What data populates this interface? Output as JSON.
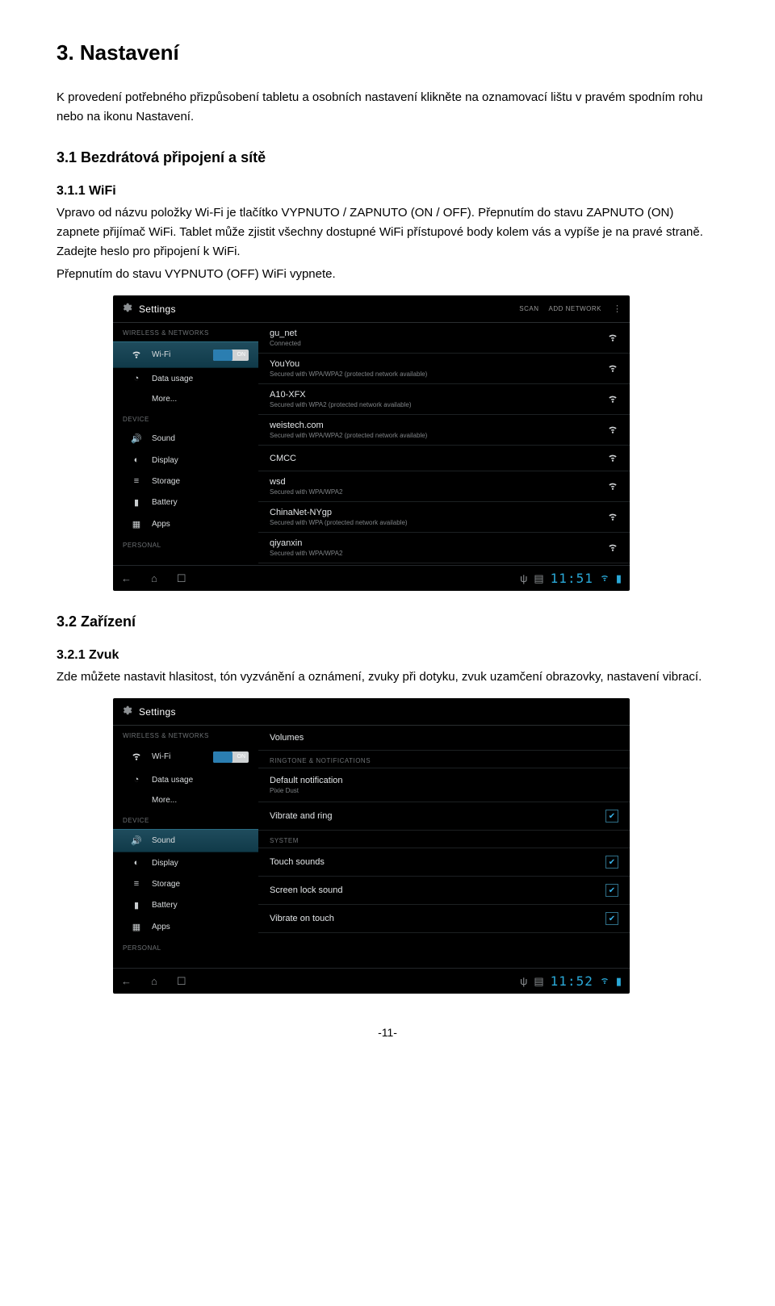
{
  "doc": {
    "h1": "3. Nastavení",
    "p1": "K provedení potřebného přizpůsobení tabletu a osobních nastavení klikněte na oznamovací lištu v pravém spodním rohu nebo na ikonu Nastavení.",
    "h2_1": "3.1 Bezdrátová připojení a sítě",
    "h3_1": "3.1.1 WiFi",
    "p2": "Vpravo od názvu položky Wi-Fi je tlačítko VYPNUTO / ZAPNUTO (ON / OFF). Přepnutím do stavu ZAPNUTO (ON) zapnete přijímač WiFi. Tablet může zjistit všechny dostupné WiFi přístupové body kolem vás a vypíše je na pravé straně. Zadejte heslo pro připojení k WiFi.",
    "p3": "Přepnutím do stavu VYPNUTO (OFF) WiFi vypnete.",
    "h2_2": "3.2 Zařízení",
    "h3_2": "3.2.1 Zvuk",
    "p4": "Zde můžete nastavit hlasitost, tón vyzvánění a oznámení, zvuky při dotyku, zvuk uzamčení obrazovky, nastavení vibrací.",
    "pagenum": "-11-"
  },
  "shot1": {
    "header": {
      "title": "Settings",
      "scan": "SCAN",
      "add": "ADD NETWORK"
    },
    "sidebar": {
      "sect_wireless": "WIRELESS & NETWORKS",
      "wifi": "Wi-Fi",
      "toggle_on": "ON",
      "data": "Data usage",
      "more": "More...",
      "sect_device": "DEVICE",
      "sound": "Sound",
      "display": "Display",
      "storage": "Storage",
      "battery": "Battery",
      "apps": "Apps",
      "sect_personal": "PERSONAL"
    },
    "networks": [
      {
        "name": "gu_net",
        "sub": "Connected"
      },
      {
        "name": "YouYou",
        "sub": "Secured with WPA/WPA2 (protected network available)"
      },
      {
        "name": "A10-XFX",
        "sub": "Secured with WPA2 (protected network available)"
      },
      {
        "name": "weistech.com",
        "sub": "Secured with WPA/WPA2 (protected network available)"
      },
      {
        "name": "CMCC",
        "sub": ""
      },
      {
        "name": "wsd",
        "sub": "Secured with WPA/WPA2"
      },
      {
        "name": "ChinaNet-NYgp",
        "sub": "Secured with WPA (protected network available)"
      },
      {
        "name": "qiyanxin",
        "sub": "Secured with WPA/WPA2"
      }
    ],
    "clock": "11:51"
  },
  "shot2": {
    "header": {
      "title": "Settings"
    },
    "sidebar": {
      "sect_wireless": "WIRELESS & NETWORKS",
      "wifi": "Wi-Fi",
      "toggle_on": "ON",
      "data": "Data usage",
      "more": "More...",
      "sect_device": "DEVICE",
      "sound": "Sound",
      "display": "Display",
      "storage": "Storage",
      "battery": "Battery",
      "apps": "Apps",
      "sect_personal": "PERSONAL"
    },
    "content": {
      "volumes": "Volumes",
      "sect_ring": "RINGTONE & NOTIFICATIONS",
      "def_notif": "Default notification",
      "def_notif_sub": "Pixie Dust",
      "vibrate_ring": "Vibrate and ring",
      "sect_sys": "SYSTEM",
      "touch_sounds": "Touch sounds",
      "screen_lock": "Screen lock sound",
      "vibrate_touch": "Vibrate on touch"
    },
    "clock": "11:52"
  }
}
